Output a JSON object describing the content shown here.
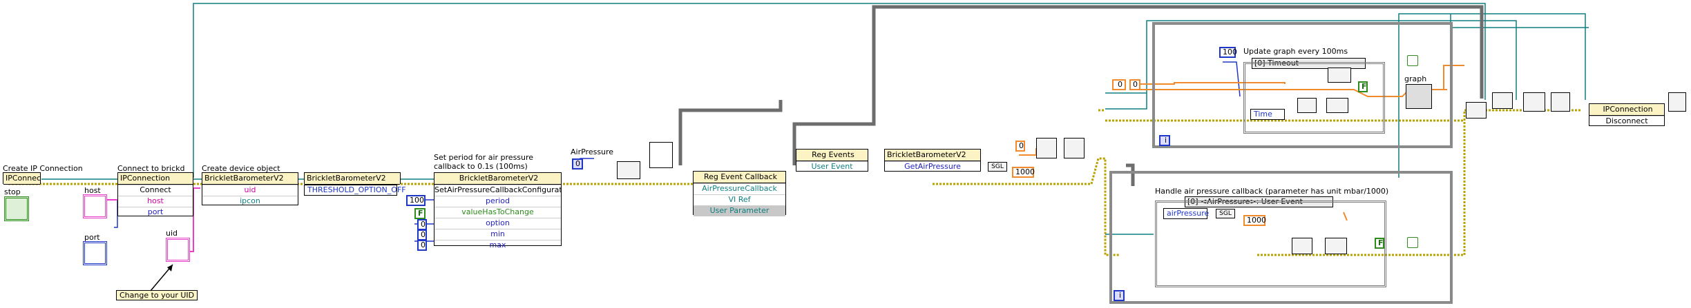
{
  "labels": {
    "create_ip": "Create IP Connection",
    "connect": "Connect to brickd",
    "create_device": "Create device object",
    "set_period_1": "Set period for air pressure",
    "set_period_2": "callback to 0.1s (100ms)",
    "air_pressure": "AirPressure",
    "update_graph": "Update graph every 100ms",
    "handle_cb": "Handle air pressure callback (parameter has unit mbar/1000)",
    "graph": "graph",
    "stop": "stop",
    "host": "host",
    "port": "port",
    "uid": "uid",
    "change_uid": "Change to your UID"
  },
  "nodes": {
    "ipconnection_create": "IPConnection",
    "ipconnection_connect_hdr": "IPConnection",
    "connect_method": "Connect",
    "host_pin": "host",
    "port_pin": "port",
    "barometer_create": "BrickletBarometerV2",
    "uid_pin": "uid",
    "ipcon_pin": "ipcon",
    "barometer_ref": "BrickletBarometerV2",
    "threshold_enum": "THRESHOLD_OPTION_OFF",
    "barometer_invoke": "BrickletBarometerV2",
    "set_cb_method": "SetAirPressureCallbackConfiguration",
    "period_pin": "period",
    "value_has_to_change_pin": "valueHasToChange",
    "option_pin": "option",
    "min_pin": "min",
    "max_pin": "max",
    "reg_event_cb": "Reg Event Callback",
    "air_pressure_cb": "AirPressureCallback",
    "vi_ref": "VI Ref",
    "user_param": "User Parameter",
    "reg_events": "Reg Events",
    "user_event": "User Event",
    "barometer_get": "BrickletBarometerV2",
    "get_air_pressure": "GetAirPressure",
    "sgl1": "SGL",
    "timeout_case": "[0] Timeout",
    "air_event_case": "[0] <AirPressure>: User Event",
    "air_pressure_term": "airPressure",
    "sgl2": "SGL",
    "time_term": "Time",
    "ipconnection_disconnect_hdr": "IPConnection",
    "disconnect_method": "Disconnect"
  },
  "constants": {
    "period": "100",
    "value_has_to_change": "F",
    "option": "0",
    "min": "0",
    "max": "0",
    "air_pressure_const": "0",
    "timeout_const": "100",
    "zero_const": "0",
    "zero_orange_a": "0",
    "zero_orange_b": "0",
    "divisor_1": "1000",
    "divisor_2": "1000",
    "false_a": "F",
    "false_b": "F",
    "iter_a": "i",
    "iter_b": "i"
  },
  "colors": {
    "header_fill": "#fbf3c4",
    "string_wire": "#e93fc8",
    "refnum_wire": "#0f7f80",
    "dbl_wire": "#f08a2a",
    "int_wire": "#1d36c8",
    "bool_wire": "#2d8b1b",
    "error_wire": "#c8b400",
    "loop_frame": "#8a8a8a"
  }
}
